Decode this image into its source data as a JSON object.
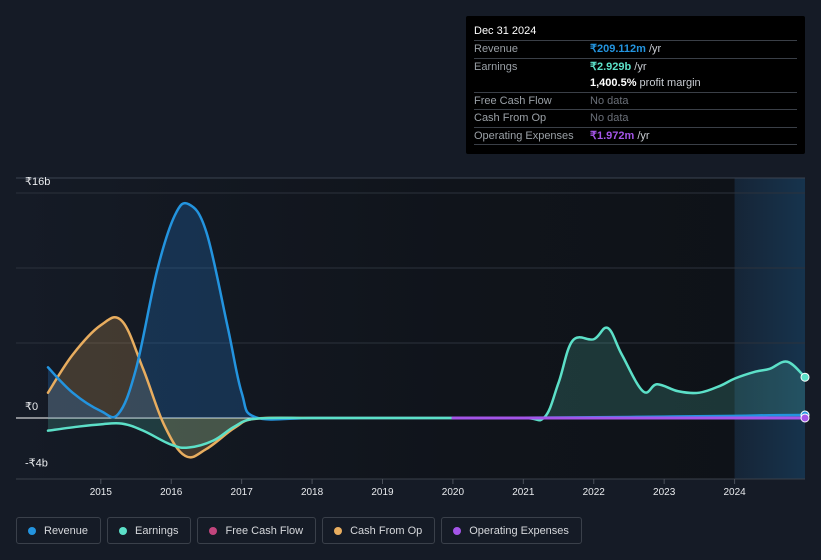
{
  "tooltip": {
    "date": "Dec 31 2024",
    "rows": [
      {
        "label": "Revenue",
        "value": "₹209.112m",
        "suffix": " /yr",
        "color": "#2394df"
      },
      {
        "label": "Earnings",
        "value": "₹2.929b",
        "suffix": " /yr",
        "color": "#5ce0c8"
      },
      {
        "label": "",
        "value": "1,400.5%",
        "suffix": " profit margin",
        "color": "#ffffff"
      },
      {
        "label": "Free Cash Flow",
        "value": "No data",
        "suffix": "",
        "color": "#6b7079"
      },
      {
        "label": "Cash From Op",
        "value": "No data",
        "suffix": "",
        "color": "#6b7079"
      },
      {
        "label": "Operating Expenses",
        "value": "₹1.972m",
        "suffix": " /yr",
        "color": "#a455e8"
      }
    ]
  },
  "legend": [
    {
      "label": "Revenue",
      "color": "#2394df"
    },
    {
      "label": "Earnings",
      "color": "#5ce0c8"
    },
    {
      "label": "Free Cash Flow",
      "color": "#c2457d"
    },
    {
      "label": "Cash From Op",
      "color": "#e8ad5f"
    },
    {
      "label": "Operating Expenses",
      "color": "#a455e8"
    }
  ],
  "chart_data": {
    "type": "area",
    "title": "",
    "xlabel": "",
    "ylabel": "",
    "y_tick_labels": [
      {
        "label": "₹16b",
        "value": 16
      },
      {
        "label": "₹0",
        "value": 0
      },
      {
        "label": "-₹4b",
        "value": -4
      }
    ],
    "x_tick_labels": [
      "2015",
      "2016",
      "2017",
      "2018",
      "2019",
      "2020",
      "2021",
      "2022",
      "2023",
      "2024"
    ],
    "x_ticks": [
      2015,
      2016,
      2017,
      2018,
      2019,
      2020,
      2021,
      2022,
      2023,
      2024
    ],
    "xlim": [
      2014.25,
      2025.0
    ],
    "ylim": [
      -4.3,
      16.5
    ],
    "gridlines_y": [
      16,
      10.67,
      5.33,
      0
    ],
    "grid": true,
    "forecast_shade_from": 2024.0,
    "legend_position": "bottom-left",
    "units": "₹ billions",
    "series": [
      {
        "name": "Revenue",
        "color": "#2394df",
        "fill": true,
        "points": [
          [
            2014.25,
            3.6
          ],
          [
            2014.6,
            1.8
          ],
          [
            2015.0,
            0.5
          ],
          [
            2015.25,
            0.3
          ],
          [
            2015.5,
            3.5
          ],
          [
            2015.8,
            10.5
          ],
          [
            2016.05,
            14.4
          ],
          [
            2016.25,
            15.2
          ],
          [
            2016.5,
            13.2
          ],
          [
            2016.8,
            6.5
          ],
          [
            2017.0,
            1.8
          ],
          [
            2017.2,
            0.05
          ],
          [
            2018,
            0
          ],
          [
            2019,
            0
          ],
          [
            2020,
            0
          ],
          [
            2021,
            0.02
          ],
          [
            2022,
            0.05
          ],
          [
            2023,
            0.1
          ],
          [
            2024,
            0.15
          ],
          [
            2024.5,
            0.2
          ],
          [
            2025.0,
            0.21
          ]
        ]
      },
      {
        "name": "Earnings",
        "color": "#5ce0c8",
        "fill": true,
        "points": [
          [
            2014.25,
            -0.9
          ],
          [
            2014.7,
            -0.6
          ],
          [
            2015.0,
            -0.45
          ],
          [
            2015.3,
            -0.4
          ],
          [
            2015.6,
            -0.9
          ],
          [
            2016.0,
            -1.9
          ],
          [
            2016.25,
            -2.1
          ],
          [
            2016.6,
            -1.6
          ],
          [
            2016.9,
            -0.6
          ],
          [
            2017.2,
            -0.05
          ],
          [
            2018,
            0
          ],
          [
            2019,
            0
          ],
          [
            2020,
            0
          ],
          [
            2021.0,
            0
          ],
          [
            2021.3,
            0.05
          ],
          [
            2021.5,
            2.5
          ],
          [
            2021.7,
            5.5
          ],
          [
            2022.0,
            5.6
          ],
          [
            2022.2,
            6.4
          ],
          [
            2022.4,
            4.5
          ],
          [
            2022.7,
            1.9
          ],
          [
            2022.9,
            2.4
          ],
          [
            2023.2,
            1.9
          ],
          [
            2023.5,
            1.8
          ],
          [
            2023.8,
            2.3
          ],
          [
            2024.0,
            2.8
          ],
          [
            2024.3,
            3.3
          ],
          [
            2024.5,
            3.5
          ],
          [
            2024.75,
            4.0
          ],
          [
            2025.0,
            2.9
          ]
        ]
      },
      {
        "name": "Free Cash Flow",
        "color": "#c2457d",
        "fill": true,
        "points": []
      },
      {
        "name": "Cash From Op",
        "color": "#e8ad5f",
        "fill": true,
        "points": [
          [
            2014.25,
            1.8
          ],
          [
            2014.6,
            4.5
          ],
          [
            2015.0,
            6.6
          ],
          [
            2015.3,
            6.9
          ],
          [
            2015.6,
            3.5
          ],
          [
            2015.9,
            -0.5
          ],
          [
            2016.2,
            -2.7
          ],
          [
            2016.5,
            -2.2
          ],
          [
            2016.9,
            -0.7
          ],
          [
            2017.2,
            -0.05
          ],
          [
            2018,
            0
          ],
          [
            2019,
            0
          ],
          [
            2020.0,
            0
          ]
        ]
      },
      {
        "name": "Operating Expenses",
        "color": "#a455e8",
        "fill": false,
        "points": [
          [
            2020.0,
            0
          ],
          [
            2021,
            0
          ],
          [
            2022,
            0
          ],
          [
            2023,
            0
          ],
          [
            2024,
            0
          ],
          [
            2025.0,
            0.002
          ]
        ]
      }
    ]
  }
}
